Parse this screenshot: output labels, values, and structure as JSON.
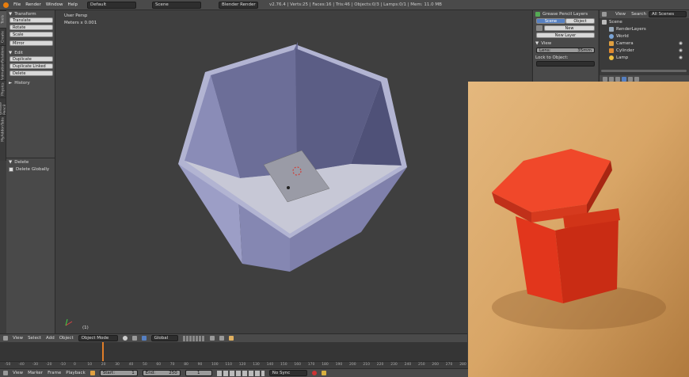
{
  "top": {
    "menus": [
      "File",
      "Render",
      "Window",
      "Help"
    ],
    "layout": "Default",
    "scene": "Scene",
    "engine": "Blender Render",
    "stats": "v2.76.4 | Verts:25 | Faces:16 | Tris:46 | Objects:0/3 | Lamps:0/1 | Mem: 11.0 MB"
  },
  "tabs": [
    "Tools",
    "Create",
    "Relations",
    "Animation",
    "Physics",
    "Grease Pencil",
    "MyAddonTabs"
  ],
  "toolshelf": {
    "transform_header": "Transform",
    "transform_buttons": [
      "Translate",
      "Rotate",
      "Scale",
      "Mirror"
    ],
    "edit_header": "Edit",
    "edit_buttons": [
      "Duplicate",
      "Duplicate Linked",
      "Delete"
    ],
    "history_header": "History",
    "delete_header": "Delete",
    "delete_option": "Delete Globally"
  },
  "viewport": {
    "view_name": "User Persp",
    "scale": "Meters x 0.001",
    "object_label": "(1)"
  },
  "props": {
    "header": "Grease Pencil Layers",
    "scene_tab": "Scene",
    "object_tab": "Object",
    "new_label": "New",
    "new_layer": "New Layer",
    "view_header": "View",
    "lens_label": "Lens:",
    "lens_value": "35mm",
    "lock_label": "Lock to Object:"
  },
  "outliner": {
    "menus": [
      "View",
      "Search"
    ],
    "filter": "All Scenes",
    "items": [
      "Scene",
      "RenderLayers",
      "World",
      "Camera",
      "Cylinder",
      "Lamp"
    ]
  },
  "view3d_header": {
    "menus": [
      "View",
      "Select",
      "Add",
      "Object"
    ],
    "mode": "Object Mode",
    "orientation": "Global"
  },
  "timeline": {
    "ticks": [
      "-50",
      "-40",
      "-30",
      "-20",
      "-10",
      "0",
      "10",
      "20",
      "30",
      "40",
      "50",
      "60",
      "70",
      "80",
      "90",
      "100",
      "110",
      "120",
      "130",
      "140",
      "150",
      "160",
      "170",
      "180",
      "190",
      "200",
      "210",
      "220",
      "230",
      "240",
      "250",
      "260",
      "270",
      "280"
    ],
    "menus": [
      "View",
      "Marker",
      "Frame",
      "Playback"
    ],
    "start_label": "Start:",
    "start": "1",
    "end_label": "End:",
    "end": "250",
    "current": "1",
    "sync": "No Sync"
  },
  "colors": {
    "accent": "#5680c2",
    "mesh_light": "#9c9ec6",
    "mesh_mid": "#7f80ab",
    "mesh_dark": "#5b5d85",
    "photo_box": "#e2361c"
  }
}
